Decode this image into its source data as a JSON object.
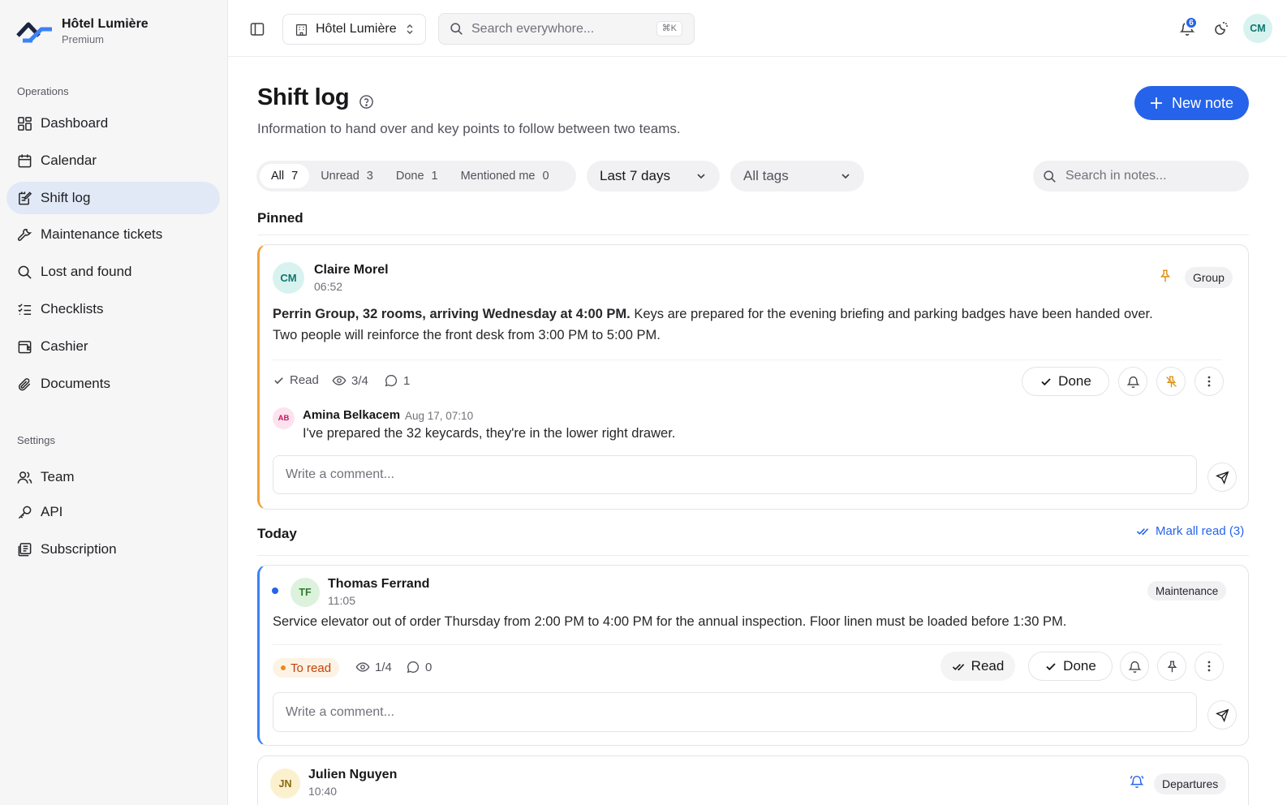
{
  "brand": {
    "name": "Hôtel Lumière",
    "plan": "Premium"
  },
  "sidebar": {
    "operations_label": "Operations",
    "items": [
      {
        "label": "Dashboard",
        "icon": "dashboard-icon"
      },
      {
        "label": "Calendar",
        "icon": "calendar-icon"
      },
      {
        "label": "Shift log",
        "icon": "shift-log-icon",
        "active": true
      },
      {
        "label": "Maintenance tickets",
        "icon": "wrench-icon"
      },
      {
        "label": "Lost and found",
        "icon": "search-icon"
      },
      {
        "label": "Checklists",
        "icon": "checklist-icon"
      },
      {
        "label": "Cashier",
        "icon": "cashier-icon"
      },
      {
        "label": "Documents",
        "icon": "paperclip-icon"
      }
    ],
    "settings_label": "Settings",
    "settings_items": [
      {
        "label": "Team",
        "icon": "users-icon"
      },
      {
        "label": "API",
        "icon": "key-icon"
      },
      {
        "label": "Subscription",
        "icon": "subscription-icon"
      }
    ]
  },
  "topbar": {
    "hotel_select": "Hôtel Lumière",
    "search_placeholder": "Search everywhore...",
    "shortcut": "⌘K",
    "notification_count": "6",
    "user_initials": "CM"
  },
  "page": {
    "title": "Shift log",
    "subtitle": "Information to hand over and key points to follow between two teams.",
    "new_note_label": "New note"
  },
  "filters": {
    "tabs": [
      {
        "label": "All",
        "count": "7",
        "active": true
      },
      {
        "label": "Unread",
        "count": "3"
      },
      {
        "label": "Done",
        "count": "1"
      },
      {
        "label": "Mentioned me",
        "count": "0"
      }
    ],
    "period": "Last 7 days",
    "tags": "All tags",
    "search_placeholder": "Search in notes..."
  },
  "pinned": {
    "heading": "Pinned",
    "note": {
      "initials": "CM",
      "author": "Claire Morel",
      "time": "06:52",
      "tag": "Group",
      "body_bold": "Perrin Group, 32 rooms, arriving Wednesday at 4:00 PM.",
      "body_rest": " Keys are prepared for the evening briefing and parking badges have been handed over.",
      "body_line2": "Two people will reinforce the front desk from 3:00 PM to 5:00 PM.",
      "read_label": "Read",
      "views": "3/4",
      "comments": "1",
      "done_label": "Done",
      "comment": {
        "initials": "AB",
        "author": "Amina Belkacem",
        "time": "Aug 17, 07:10",
        "text": "I've prepared the 32 keycards, they're in the lower right drawer."
      },
      "comment_placeholder": "Write a comment..."
    }
  },
  "today": {
    "heading": "Today",
    "mark_all_read": "Mark all read (3)",
    "notes": [
      {
        "initials": "TF",
        "author": "Thomas Ferrand",
        "time": "11:05",
        "tag": "Maintenance",
        "body": "Service elevator out of order Thursday from 2:00 PM to 4:00 PM for the annual inspection. Floor linen must be loaded before 1:30 PM.",
        "status": "To read",
        "views": "1/4",
        "comments": "0",
        "read_label": "Read",
        "done_label": "Done",
        "comment_placeholder": "Write a comment..."
      },
      {
        "initials": "JN",
        "author": "Julien Nguyen",
        "time": "10:40",
        "tag": "Departures"
      }
    ]
  },
  "colors": {
    "accent": "#2563eb",
    "pinned_border": "#f0a23b",
    "unread_border": "#3b82f6",
    "sidebar_active": "#e1e9f6"
  }
}
